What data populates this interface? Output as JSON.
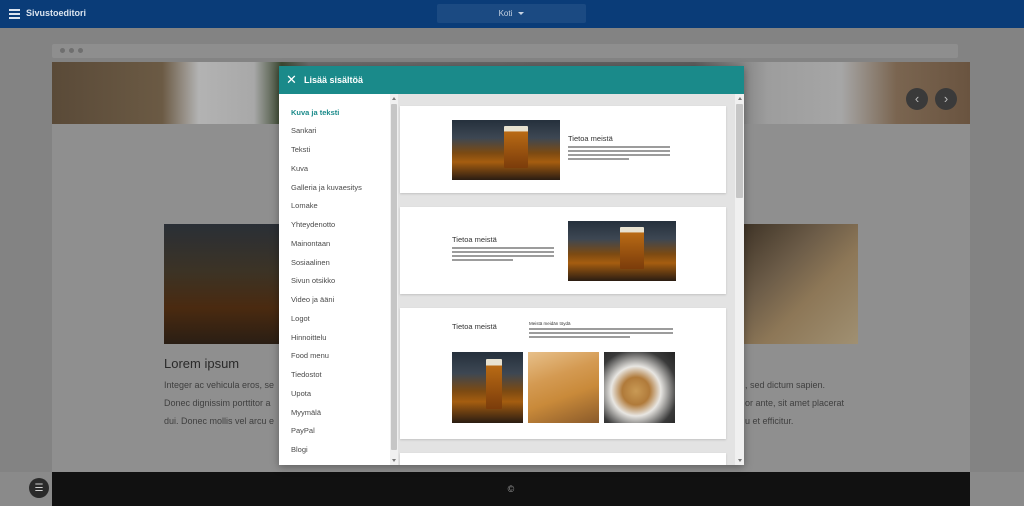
{
  "app": {
    "title": "Sivustoeditori",
    "page_select": "Koti"
  },
  "background_page": {
    "heading": "Lorem ipsum",
    "text_left": [
      "Integer ac vehicula eros, se",
      "Donec dignissim porttitor a",
      "dui. Donec mollis vel arcu e"
    ],
    "text_right": [
      ", sed dictum sapien.",
      "or ante, sit amet placerat",
      "u et efficitur."
    ],
    "arrow_prev": "‹",
    "arrow_next": "›",
    "footer_text": "©"
  },
  "modal": {
    "title": "Lisää sisältöä",
    "categories": [
      {
        "label": "Kuva ja teksti",
        "active": true
      },
      {
        "label": "Sankari"
      },
      {
        "label": "Teksti"
      },
      {
        "label": "Kuva"
      },
      {
        "label": "Galleria ja kuvaesitys"
      },
      {
        "label": "Lomake"
      },
      {
        "label": "Yhteydenotto"
      },
      {
        "label": "Mainontaan"
      },
      {
        "label": "Sosiaalinen"
      },
      {
        "label": "Sivun otsikko"
      },
      {
        "label": "Video ja ääni"
      },
      {
        "label": "Logot"
      },
      {
        "label": "Hinnoittelu"
      },
      {
        "label": "Food menu"
      },
      {
        "label": "Tiedostot"
      },
      {
        "label": "Upota"
      },
      {
        "label": "Myymälä"
      },
      {
        "label": "PayPal"
      },
      {
        "label": "Blogi"
      }
    ],
    "templates": [
      {
        "title": "Tietoa meistä"
      },
      {
        "title": "Tietoa meistä"
      },
      {
        "title": "Tietoa meistä",
        "subtitle": "Meistä meidän töydä"
      }
    ]
  },
  "colors": {
    "topbar": "#0a3c78",
    "modal_header": "#1a8a8a",
    "active_category": "#1a8a8a"
  }
}
